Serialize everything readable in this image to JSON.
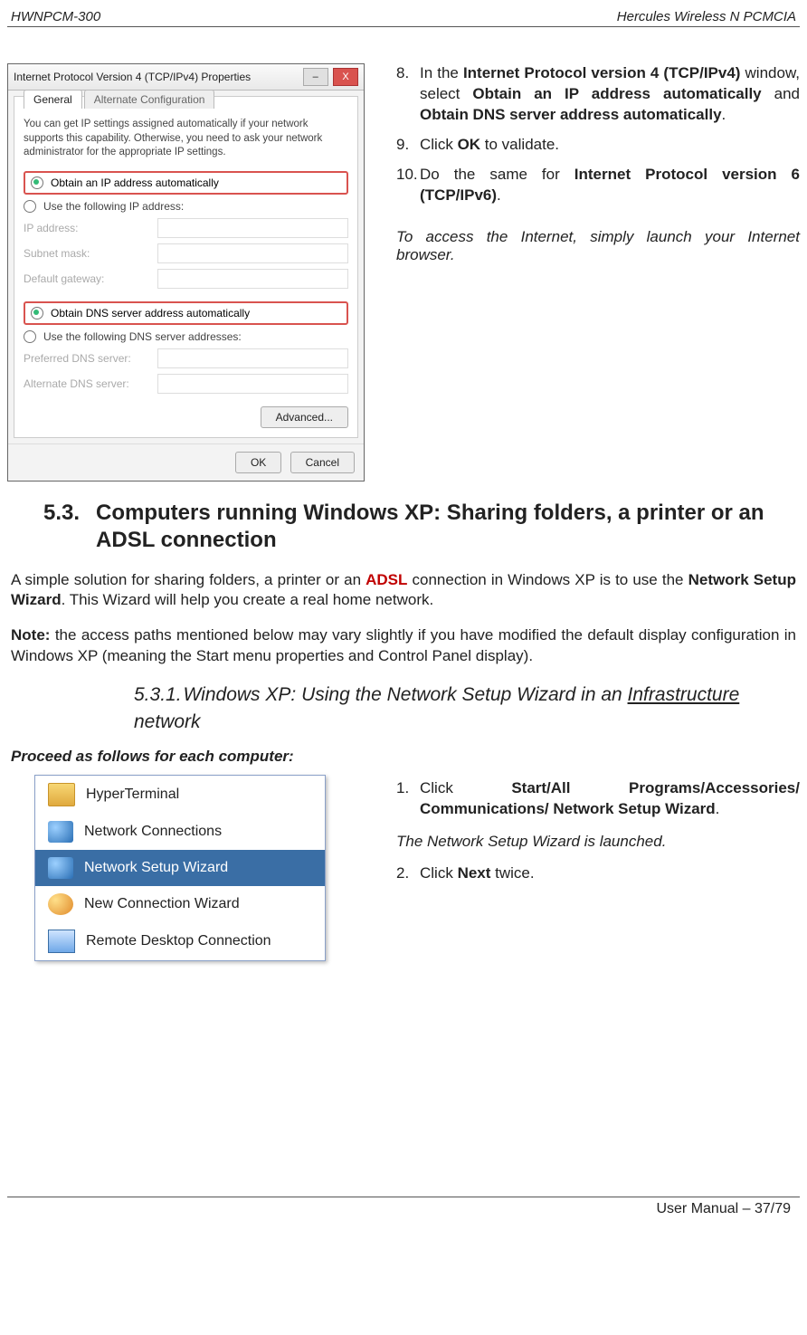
{
  "header": {
    "left": "HWNPCM-300",
    "right": "Hercules Wireless N PCMCIA"
  },
  "dialog": {
    "title": "Internet Protocol Version 4 (TCP/IPv4) Properties",
    "tabs": [
      "General",
      "Alternate Configuration"
    ],
    "description": "You can get IP settings assigned automatically if your network supports this capability. Otherwise, you need to ask your network administrator for the appropriate IP settings.",
    "opt_ip_auto": "Obtain an IP address automatically",
    "opt_ip_manual": "Use the following IP address:",
    "lbl_ip": "IP address:",
    "lbl_mask": "Subnet mask:",
    "lbl_gw": "Default gateway:",
    "opt_dns_auto": "Obtain DNS server address automatically",
    "opt_dns_manual": "Use the following DNS server addresses:",
    "lbl_dns1": "Preferred DNS server:",
    "lbl_dns2": "Alternate DNS server:",
    "btn_adv": "Advanced...",
    "btn_ok": "OK",
    "btn_cancel": "Cancel"
  },
  "steps_a": {
    "n8": "8.",
    "t8_a": "In the ",
    "t8_b": "Internet Protocol version 4 (TCP/IPv4)",
    "t8_c": " window, select ",
    "t8_d": "Obtain an IP address automatically",
    "t8_e": " and ",
    "t8_f": "Obtain DNS server address automatically",
    "t8_g": ".",
    "n9": "9.",
    "t9_a": "Click ",
    "t9_b": "OK",
    "t9_c": " to validate.",
    "n10": "10.",
    "t10_a": "Do the same for ",
    "t10_b": "Internet Protocol version 6 (TCP/IPv6)",
    "t10_c": ".",
    "note": "To access the Internet, simply launch your Internet browser."
  },
  "sec53": {
    "num": "5.3.",
    "title": "Computers running Windows XP: Sharing folders, a printer or an ADSL connection"
  },
  "para1_a": "A simple solution for sharing folders, a printer or an ",
  "para1_adsl": "ADSL",
  "para1_b": " connection in Windows XP is to use the ",
  "para1_c": "Network Setup Wizard",
  "para1_d": ".  This Wizard will help you create a real home network.",
  "para2_a": "Note:",
  "para2_b": " the access paths mentioned below may vary slightly if you have modified the default display configuration in Windows XP (meaning the Start menu properties and Control Panel display).",
  "sec531": {
    "num": "5.3.1.",
    "t_a": "Windows XP: Using the Network Setup Wizard in an ",
    "t_b": "Infrastructure",
    "t_c": " network"
  },
  "proceed": "Proceed as follows for each computer:",
  "xpmenu": {
    "items": [
      "HyperTerminal",
      "Network Connections",
      "Network Setup Wizard",
      "New Connection Wizard",
      "Remote Desktop Connection"
    ]
  },
  "steps_b": {
    "n1": "1.",
    "t1_a": "Click ",
    "t1_b": "Start/All Programs/Accessories/ Communications/ Network Setup Wizard",
    "t1_c": ".",
    "note": "The Network Setup Wizard is launched.",
    "n2": "2.",
    "t2_a": "Click ",
    "t2_b": "Next",
    "t2_c": " twice."
  },
  "footer": "User Manual – 37/79"
}
